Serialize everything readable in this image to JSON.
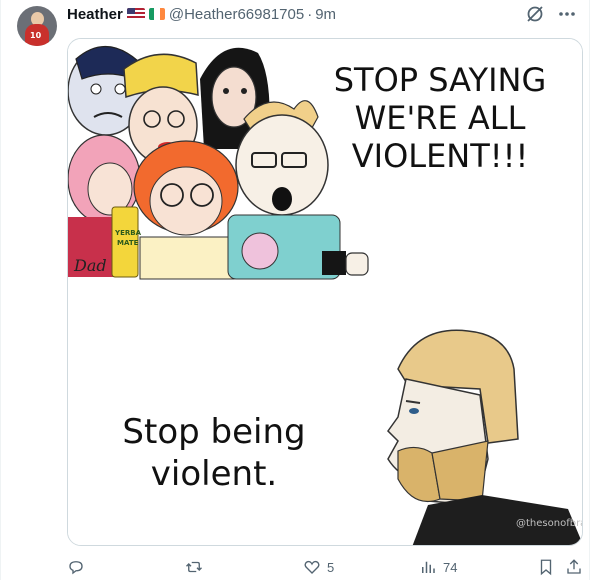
{
  "post": {
    "author_name": "Heather",
    "flags": [
      "us-flag",
      "ireland-flag"
    ],
    "handle": "@Heather66981705",
    "separator": "·",
    "time": "9m"
  },
  "avatar": {
    "jersey_number": "10"
  },
  "meme": {
    "top_text_line1": "STOP SAYING",
    "top_text_line2": "WE'RE ALL",
    "top_text_line3": "VIOLENT!!!",
    "bottom_text_line1": "Stop being",
    "bottom_text_line2": "violent.",
    "watermark": "@thesonofbran",
    "can_label_line1": "YERBA",
    "can_label_line2": "MATE",
    "sign_text": "Dad"
  },
  "actions": {
    "reply_count": "",
    "repost_count": "",
    "like_count": "5",
    "views_count": "74"
  },
  "icons": {
    "grok": "grok-icon",
    "more": "more-icon",
    "reply": "reply-icon",
    "repost": "repost-icon",
    "like": "heart-icon",
    "views": "views-icon",
    "bookmark": "bookmark-icon",
    "share": "share-icon"
  },
  "colors": {
    "text_primary": "#0f1419",
    "text_secondary": "#536471",
    "border": "#cfd9de",
    "beard_blond": "#e8c98a"
  }
}
